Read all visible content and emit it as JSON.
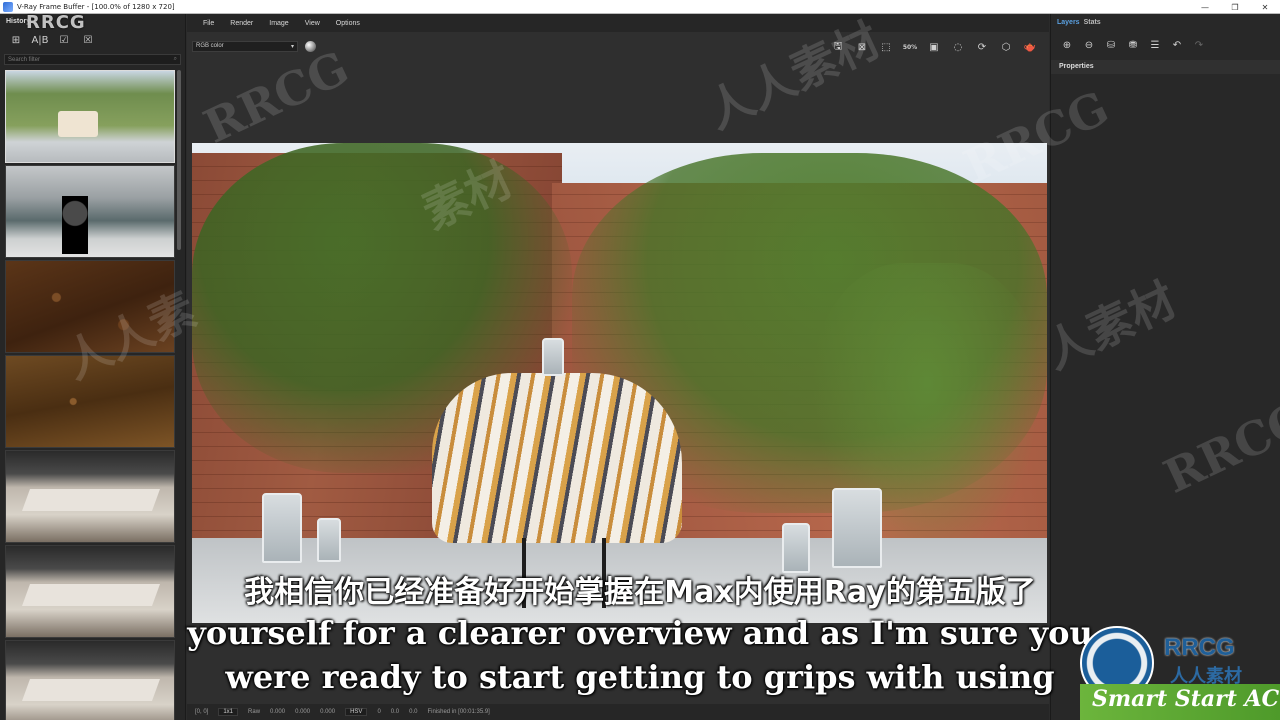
{
  "window": {
    "title": "V-Ray Frame Buffer - [100.0% of 1280 x 720]",
    "controls": [
      "—",
      "❐",
      "✕"
    ]
  },
  "history": {
    "header": "History",
    "search_placeholder": "Search filter",
    "toolbar_icons": [
      "save-history-icon",
      "compare-ab-icon",
      "load-history-icon",
      "remove-history-icon"
    ]
  },
  "menu": {
    "items": [
      "File",
      "Render",
      "Image",
      "View",
      "Options"
    ]
  },
  "viewport": {
    "channel": "RGB color",
    "zoom_badge": "50%"
  },
  "status": {
    "coords": "[0, 0]",
    "ratio": "1x1",
    "mode": "Raw",
    "r": "0.000",
    "g": "0.000",
    "b": "0.000",
    "colorspace": "HSV",
    "h": "0",
    "s": "0.0",
    "v": "0.0",
    "finished": "Finished in [00:01:35.9]"
  },
  "right_panel": {
    "tabs": [
      "Layers",
      "Stats"
    ],
    "properties_header": "Properties"
  },
  "subtitles": {
    "zh": "我相信你已经准备好开始掌握在Max内使用Ray的第五版了",
    "en_line1": "yourself for a clearer overview and as I'm sure you",
    "en_line2": "were ready to start getting to grips with using"
  },
  "watermarks": {
    "corner": "RRCG",
    "brand_name": "RRCG",
    "brand_sub": "人人素材",
    "brand_strip": "Smart Start AC"
  }
}
